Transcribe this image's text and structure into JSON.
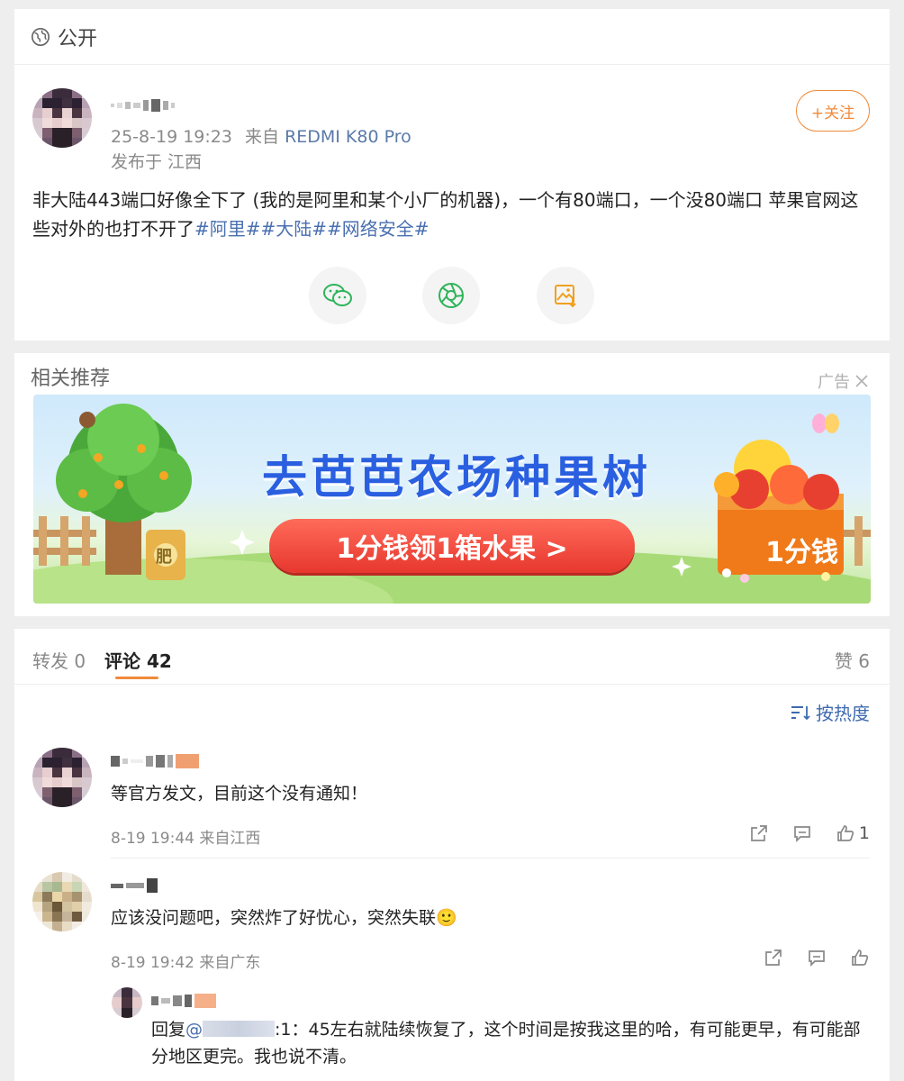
{
  "visibility": {
    "label": "公开",
    "icon": "globe-icon"
  },
  "post": {
    "time": "25-8-19 19:23",
    "from_prefix": "来自",
    "device": "REDMI K80 Pro",
    "location": "发布于 江西",
    "follow_label": "+关注",
    "text": "非大陆443端口好像全下了 (我的是阿里和某个小厂的机器)，一个有80端口，一个没80端口 苹果官网这些对外的也打不开了",
    "hashtags": [
      "#阿里#",
      "#大陆#",
      "#网络安全#"
    ],
    "share_icons": [
      "wechat-icon",
      "moments-icon",
      "save-image-icon"
    ]
  },
  "recommend": {
    "title": "相关推荐",
    "ad_label": "广告",
    "ad_headline": "去芭芭农场种果树",
    "ad_cta": "1分钱领1箱水果 >",
    "ad_box_text": "1分钱",
    "ad_bag_text": "肥"
  },
  "comments_section": {
    "tabs": [
      {
        "label": "转发 0"
      },
      {
        "label": "评论 42"
      }
    ],
    "likes_label": "赞 6",
    "sort_label": "按热度",
    "comments": [
      {
        "text": "等官方发文，目前这个没有通知！",
        "time": "8-19 19:44 来自江西",
        "likes": "1"
      },
      {
        "text": "应该没问题吧，突然炸了好忧心，突然失联🙂",
        "time": "8-19 19:42 来自广东",
        "likes": ""
      }
    ],
    "reply": {
      "prefix": "回复",
      "mention_at": "@",
      "suffix": ":1：45左右就陆续恢复了，这个时间是按我这里的哈，有可能更早，有可能部分地区更完。我也说不清。"
    }
  },
  "colors": {
    "accent": "#f08a3a",
    "link": "#4a6fb0",
    "ad_blue": "#2a5fe0",
    "ad_red": "#e7372e"
  }
}
